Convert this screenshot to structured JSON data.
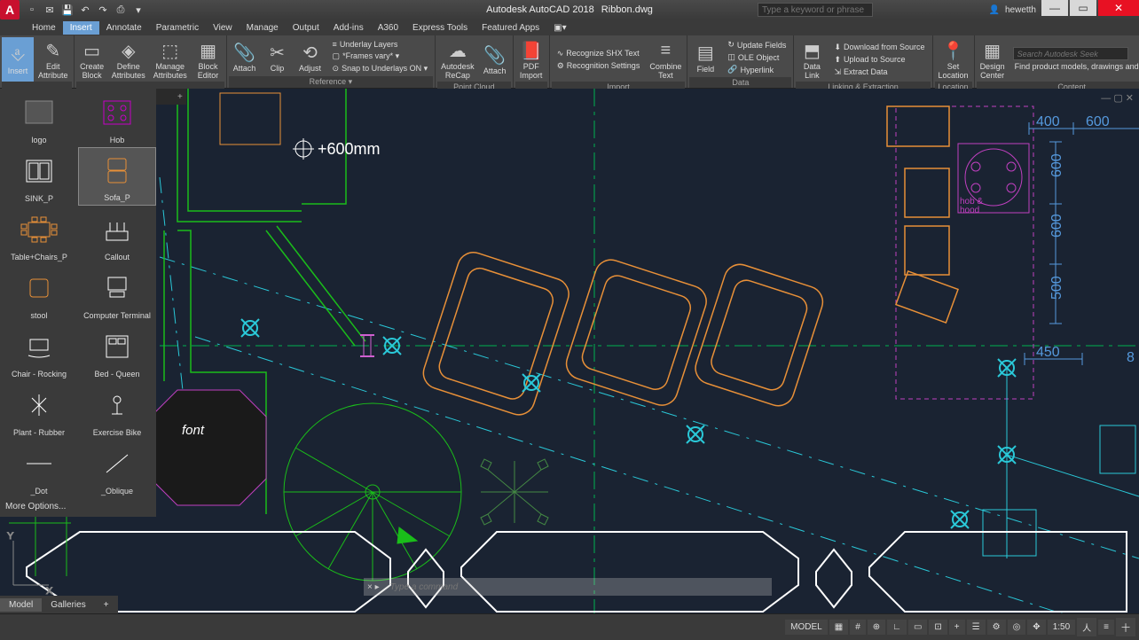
{
  "title": {
    "app": "Autodesk AutoCAD 2018",
    "file": "Ribbon.dwg"
  },
  "search_placeholder": "Type a keyword or phrase",
  "user": "hewetth",
  "menubar": [
    "Home",
    "Insert",
    "Annotate",
    "Parametric",
    "View",
    "Manage",
    "Output",
    "Add-ins",
    "A360",
    "Express Tools",
    "Featured Apps"
  ],
  "menubar_active": "Insert",
  "ribbon": {
    "panels": [
      {
        "label": "",
        "items_big": [
          [
            "⎀",
            "Insert"
          ],
          [
            "✎",
            "Edit Attribute"
          ]
        ]
      },
      {
        "label": "",
        "items_big": [
          [
            "▭",
            "Create Block"
          ],
          [
            "◈",
            "Define Attributes"
          ],
          [
            "⬚",
            "Manage Attributes"
          ],
          [
            "▦",
            "Block Editor"
          ]
        ]
      },
      {
        "label": "Reference ▾",
        "items_big": [
          [
            "📎",
            "Attach"
          ],
          [
            "✂",
            "Clip"
          ],
          [
            "⟲",
            "Adjust"
          ]
        ],
        "items_rows": [
          "Underlay Layers",
          "*Frames vary* ▾",
          "Snap to Underlays ON ▾"
        ]
      },
      {
        "label": "Point Cloud",
        "items_big": [
          [
            "☁",
            "Autodesk ReCap"
          ],
          [
            "📎",
            "Attach"
          ]
        ]
      },
      {
        "label": "",
        "items_big": [
          [
            "📄",
            "PDF Import"
          ]
        ]
      },
      {
        "label": "Import",
        "items_rows": [
          "Recognize SHX Text",
          "Recognition Settings"
        ],
        "items_big_after": [
          [
            "≡",
            "Combine Text"
          ]
        ]
      },
      {
        "label": "Data",
        "items_big": [
          [
            "▤",
            "Field"
          ]
        ],
        "items_rows": [
          "Update Fields",
          "OLE Object",
          "Hyperlink"
        ]
      },
      {
        "label": "Linking & Extraction",
        "items_big": [
          [
            "⬒",
            "Data Link"
          ]
        ],
        "items_rows": [
          "Download from Source",
          "Upload to Source",
          "Extract Data"
        ]
      },
      {
        "label": "Location",
        "items_big": [
          [
            "📍",
            "Set Location"
          ]
        ]
      },
      {
        "label": "Content",
        "items_big": [
          [
            "▦",
            "Design Center"
          ]
        ],
        "seek_placeholder": "Search Autodesk Seek",
        "seek_text": "Find product models, drawings and specs"
      }
    ]
  },
  "palette": {
    "items": [
      {
        "name": "logo"
      },
      {
        "name": "Hob"
      },
      {
        "name": "SINK_P"
      },
      {
        "name": "Sofa_P"
      },
      {
        "name": "Table+Chairs_P"
      },
      {
        "name": "Callout"
      },
      {
        "name": "stool"
      },
      {
        "name": "Computer Terminal"
      },
      {
        "name": "Chair - Rocking"
      },
      {
        "name": "Bed - Queen"
      },
      {
        "name": "Plant - Rubber"
      },
      {
        "name": "Exercise Bike"
      },
      {
        "name": "_Dot"
      },
      {
        "name": "_Oblique"
      }
    ],
    "selected": 3,
    "more": "More Options..."
  },
  "canvas": {
    "annotation": "+600mm",
    "font_label": "font",
    "dims": {
      "d400": "400",
      "d600a": "600",
      "d600b": "600",
      "d600c": "600",
      "d500": "500",
      "d450": "450",
      "d8": "8"
    },
    "hob_text": "hob & hood"
  },
  "file_tabs": {
    "plus": "+"
  },
  "layout_tabs": [
    "Model",
    "Galleries",
    "+"
  ],
  "layout_active": "Model",
  "command": {
    "placeholder": "Type a command",
    "prefix": "×  ▸"
  },
  "status": {
    "model": "MODEL",
    "scale": "1:50",
    "icons": [
      "▦",
      "#",
      "⊕",
      "∟",
      "▭",
      "⊡",
      "+",
      "☰",
      "⚙",
      "◎",
      "✥",
      "人",
      "≡",
      "十"
    ]
  }
}
